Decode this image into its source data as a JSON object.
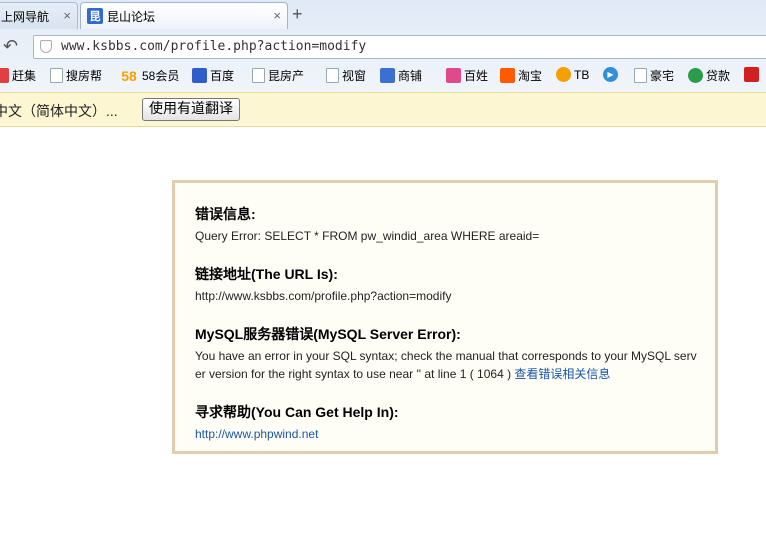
{
  "browser": {
    "tabs": [
      {
        "label": "上网导航",
        "close": "×"
      },
      {
        "label": "昆山论坛",
        "favicon": "昆",
        "close": "×"
      }
    ],
    "new_tab": "+",
    "address": "www.ksbbs.com/profile.php?action=modify",
    "bookmarks": [
      {
        "label": "赶集",
        "icon": "ganji-icon",
        "color": "#e04040"
      },
      {
        "label": "搜房帮",
        "icon": "page-icon",
        "color": ""
      },
      {
        "label": "58会员",
        "prefix": "58",
        "icon": "58-icon",
        "color": "#f5a000"
      },
      {
        "label": "百度",
        "icon": "baidu-icon",
        "color": "#2f5ec9"
      },
      {
        "label": "昆房产",
        "icon": "page-icon",
        "color": ""
      },
      {
        "label": "视窗",
        "icon": "page-icon",
        "color": ""
      },
      {
        "label": "商铺",
        "icon": "shop-icon",
        "color": "#3b6fd0"
      },
      {
        "label": "百姓",
        "icon": "baixing-icon",
        "color": "#e04a8a"
      },
      {
        "label": "淘宝",
        "icon": "taobao-icon",
        "color": "#ff5a00"
      },
      {
        "label": "TB",
        "icon": "tb-icon",
        "color": "#f5a000"
      },
      {
        "label": "",
        "icon": "play-icon",
        "color": "#2f8fd8"
      },
      {
        "label": "豪宅",
        "icon": "page-icon",
        "color": ""
      },
      {
        "label": "贷款",
        "icon": "loan-icon",
        "color": "#2a9d4a"
      },
      {
        "label": "",
        "icon": "m-icon",
        "color": "#d02020"
      }
    ]
  },
  "translate": {
    "text": "中文（简体中文）...",
    "button": "使用有道翻译"
  },
  "error": {
    "sections": [
      {
        "title": "错误信息:",
        "text": "Query Error: SELECT * FROM pw_windid_area WHERE areaid="
      },
      {
        "title": "链接地址(The URL Is):",
        "text": "http://www.ksbbs.com/profile.php?action=modify"
      },
      {
        "title": "MySQL服务器错误(MySQL Server Error):",
        "text": "You have an error in your SQL syntax; check the manual that corresponds to your MySQL server version for the right syntax to use near '' at line 1 ( 1064 ) ",
        "link": "查看错误相关信息"
      },
      {
        "title": "寻求帮助(You Can Get Help In):",
        "link": "http://www.phpwind.net"
      }
    ]
  },
  "colors": {
    "link": "#1a56a6",
    "box_border": "#e1ccb0",
    "box_bg": "#fffef6",
    "translate_bg": "#fdf6d2"
  }
}
